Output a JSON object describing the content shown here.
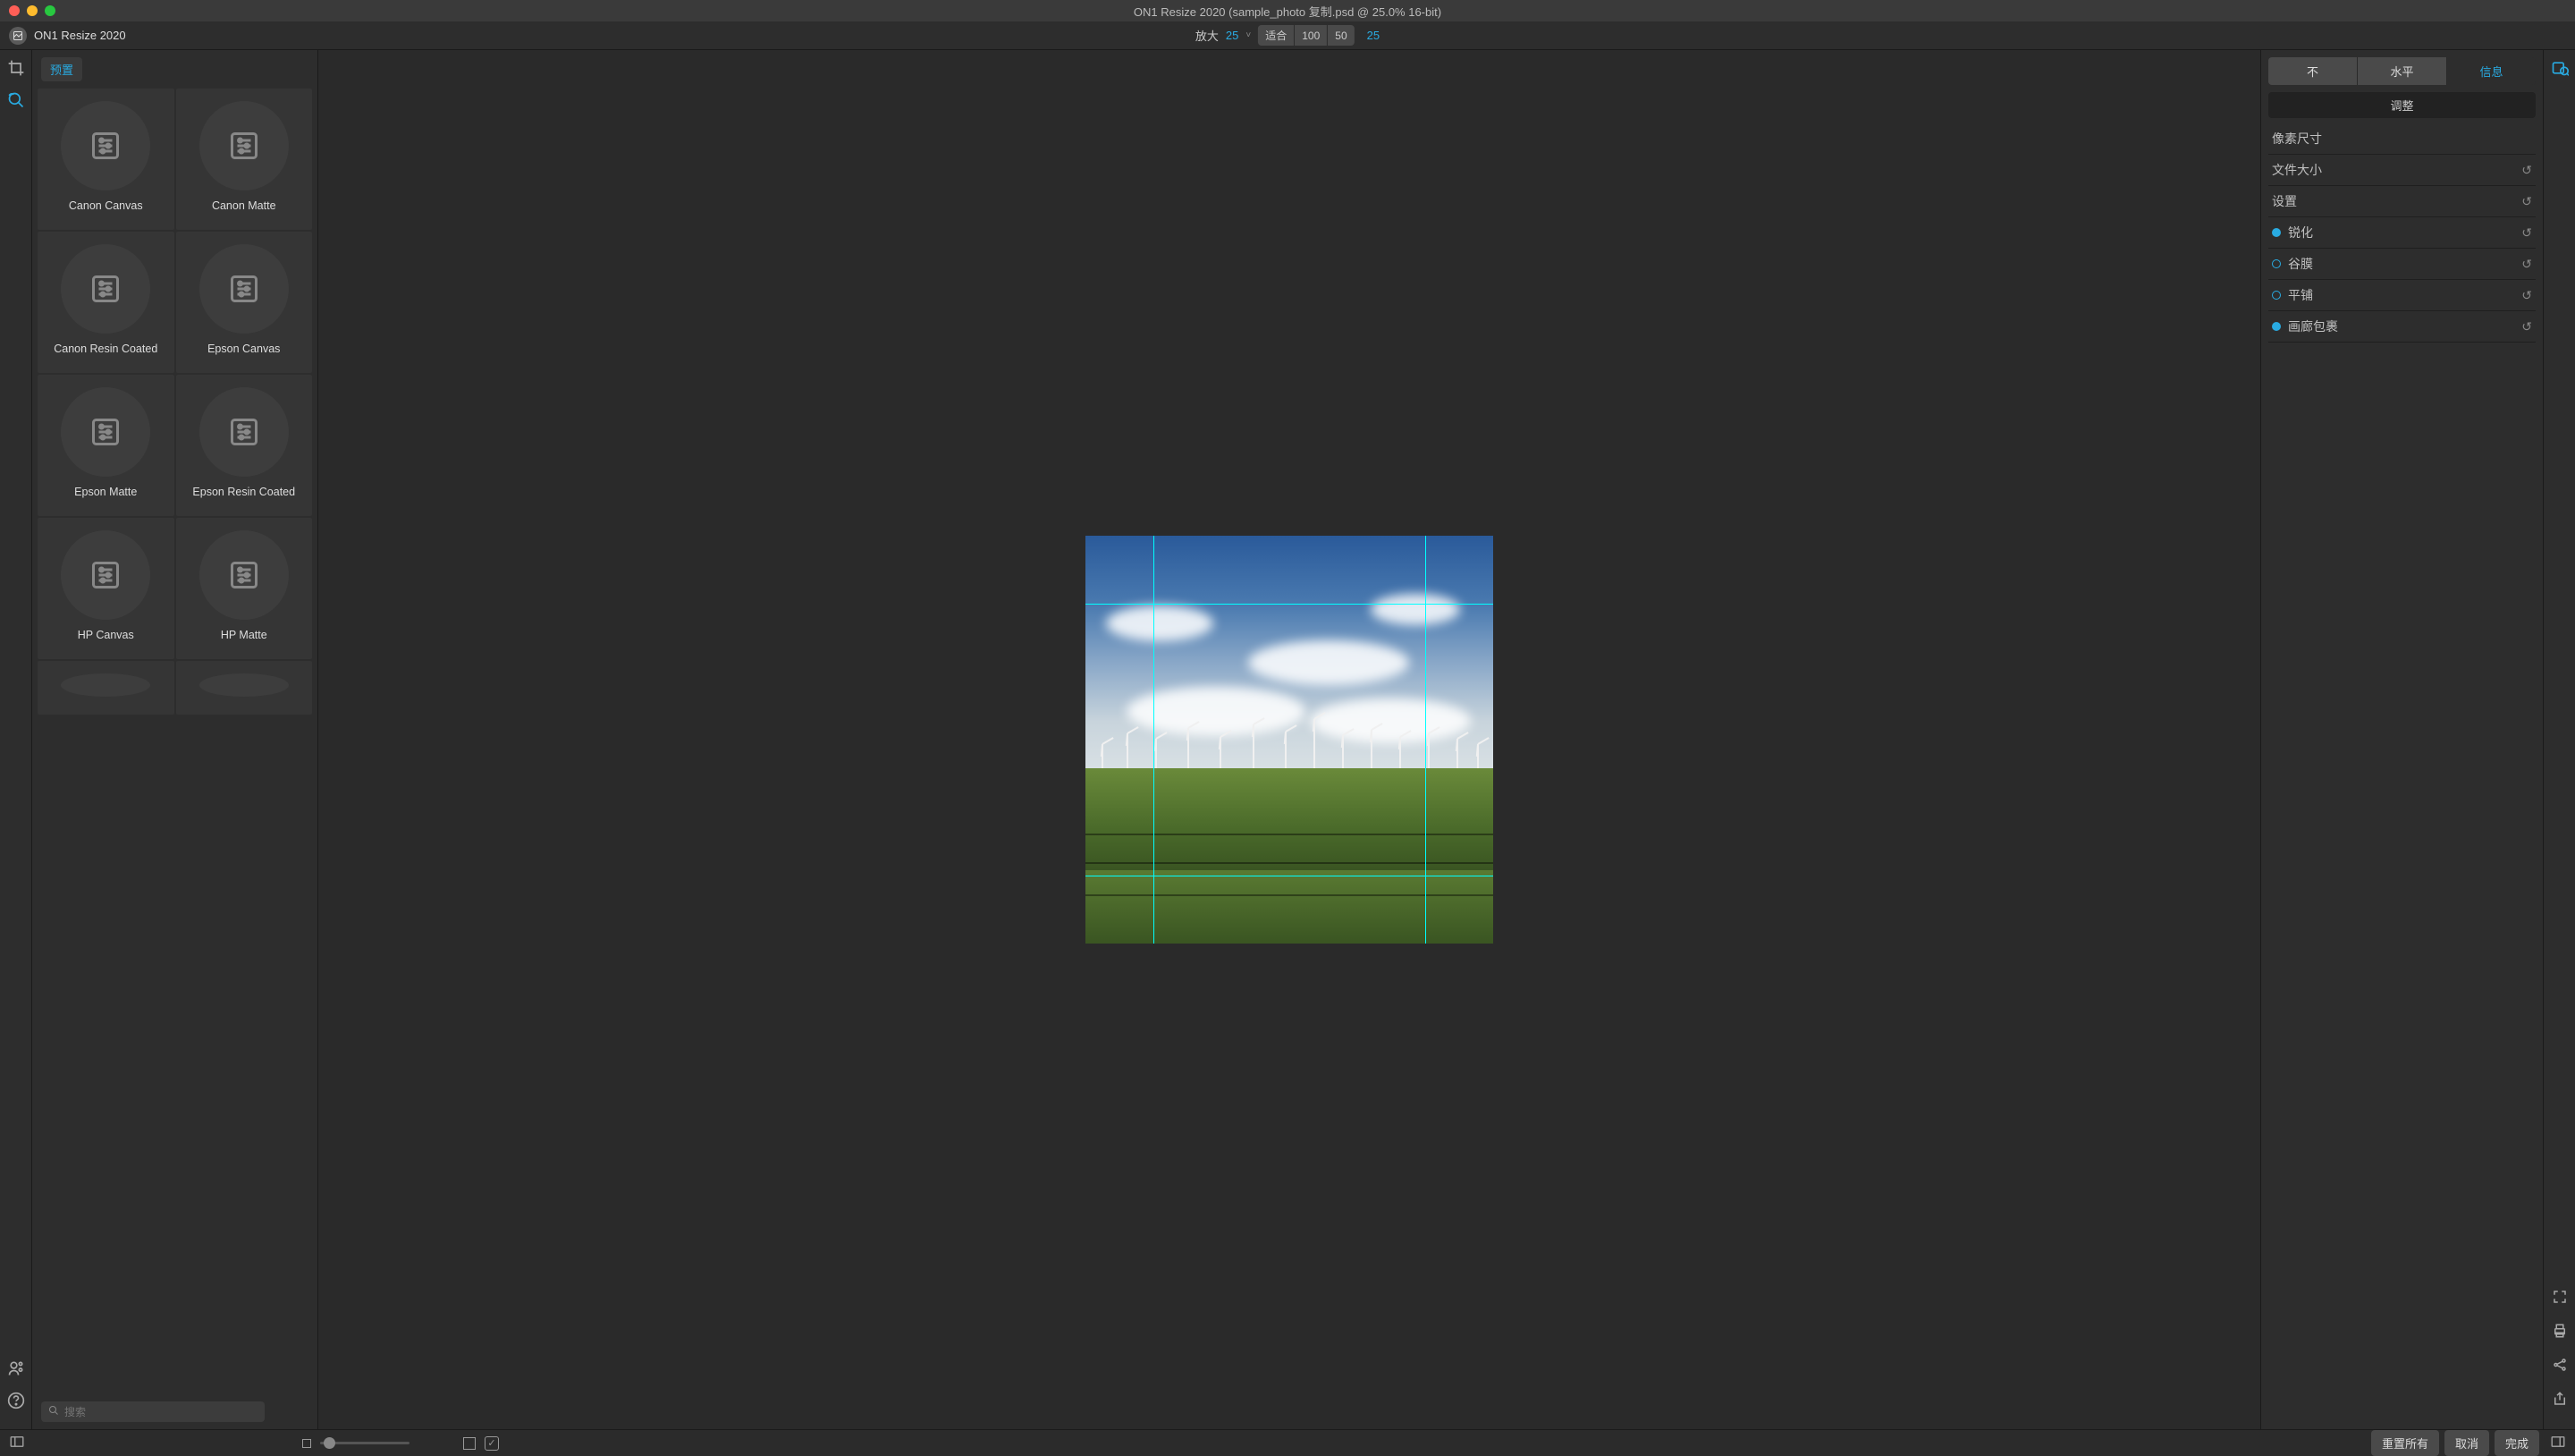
{
  "window": {
    "title": "ON1 Resize 2020 (sample_photo 复制.psd @ 25.0% 16-bit)"
  },
  "app": {
    "name": "ON1 Resize 2020"
  },
  "zoom": {
    "label": "放大",
    "value": "25",
    "fit": "适合",
    "p100": "100",
    "p50": "50",
    "active": "25"
  },
  "presets": {
    "tab": "预置",
    "items": [
      {
        "label": "Canon Canvas"
      },
      {
        "label": "Canon Matte"
      },
      {
        "label": "Canon Resin Coated"
      },
      {
        "label": "Epson Canvas"
      },
      {
        "label": "Epson Matte"
      },
      {
        "label": "Epson Resin Coated"
      },
      {
        "label": "HP Canvas"
      },
      {
        "label": "HP Matte"
      }
    ],
    "search_placeholder": "搜索"
  },
  "right": {
    "tabs": {
      "t1": "不",
      "t2": "水平",
      "t3": "信息"
    },
    "adjust": "调整",
    "sections": {
      "pixel": "像素尺寸",
      "filesize": "文件大小",
      "settings": "设置",
      "sharpen": "锐化",
      "film": "谷膜",
      "tile": "平铺",
      "gallery": "画廊包裹"
    }
  },
  "bottom": {
    "reset_all": "重置所有",
    "cancel": "取消",
    "done": "完成"
  }
}
